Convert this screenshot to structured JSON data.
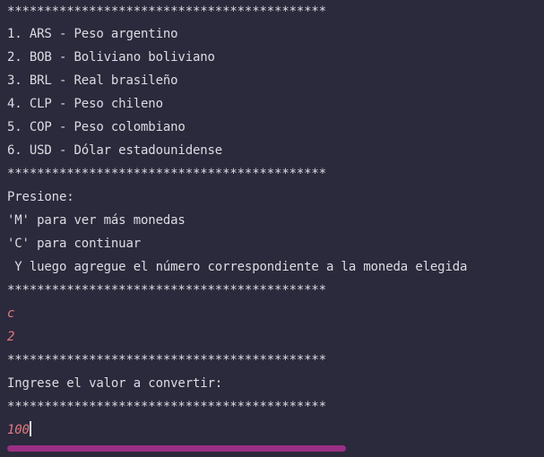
{
  "console": {
    "lines": {
      "sep1": "*******************************************",
      "opt1": "1. ARS - Peso argentino",
      "opt2": "2. BOB - Boliviano boliviano",
      "opt3": "3. BRL - Real brasileño",
      "opt4": "4. CLP - Peso chileno",
      "opt5": "5. COP - Peso colombiano",
      "opt6": "6. USD - Dólar estadounidense",
      "sep2": "*******************************************",
      "prompt_header": "Presione:",
      "prompt_m": "'M' para ver más monedas",
      "prompt_c": "'C' para continuar",
      "prompt_then": " Y luego agregue el número correspondiente a la moneda elegida",
      "sep3": "*******************************************",
      "input1": "c",
      "input2": "2",
      "sep4": "*******************************************",
      "value_prompt": "Ingrese el valor a convertir:",
      "sep5": "*******************************************",
      "input3": "100"
    },
    "colors": {
      "background": "#2b2a3c",
      "output_text": "#dcdce4",
      "user_input": "#e3797f",
      "scrollbar": "#9b2f86"
    }
  }
}
